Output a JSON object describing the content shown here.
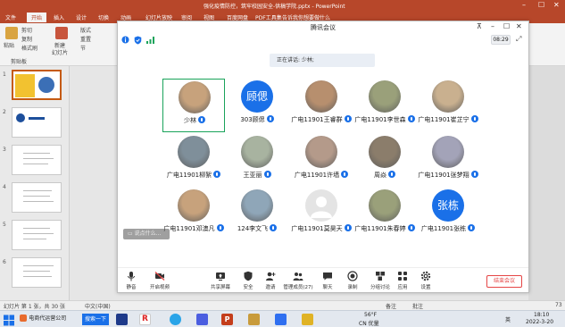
{
  "powerpoint": {
    "title": "强化疫情防控，筑牢校园安全-供稿学院.pptx  -  PowerPoint",
    "tabs": [
      "文件",
      "开始",
      "插入",
      "设计",
      "切换",
      "动画",
      "幻灯片放映",
      "审阅",
      "视图",
      "百度网盘",
      "PDF工具集"
    ],
    "active_tab": "开始",
    "search_placeholder": "告诉我你想要做什么",
    "ribbon": {
      "paste": "粘贴",
      "cut": "剪切",
      "copy": "复制",
      "format_painter": "格式刷",
      "clipboard_group": "剪贴板",
      "new_slide": "新建",
      "new_slide_2": "幻灯片",
      "layout": "版式",
      "reset": "重置",
      "section": "节"
    },
    "slide_numbers": [
      "1",
      "2",
      "3",
      "4",
      "5",
      "6"
    ],
    "status": {
      "slide_info": "幻灯片 第 1 张，共 30 张",
      "language": "中文(中国)",
      "notes": "备注",
      "comments": "批注",
      "zoom": "73"
    }
  },
  "meeting": {
    "title": "腾讯会议",
    "clock": "08:29",
    "speaking": "正在讲话: 少林;",
    "chat_placeholder": "说点什么...",
    "participants": [
      {
        "name": "少林",
        "avatar": "photo",
        "selected": true
      },
      {
        "name": "303顾偲",
        "avatar": "text",
        "avatar_text": "顾偲"
      },
      {
        "name": "广电11901王睿群",
        "avatar": "photo"
      },
      {
        "name": "广电11901李世森",
        "avatar": "photo"
      },
      {
        "name": "广电11901崔芷宁",
        "avatar": "photo"
      },
      {
        "name": "广电11901柳絮",
        "avatar": "photo"
      },
      {
        "name": "王亚丽",
        "avatar": "photo"
      },
      {
        "name": "广电11901许墙",
        "avatar": "photo"
      },
      {
        "name": "周焱",
        "avatar": "photo"
      },
      {
        "name": "广电11901张梦翔",
        "avatar": "photo"
      },
      {
        "name": "广电11901邓澳凡",
        "avatar": "photo"
      },
      {
        "name": "124李文飞",
        "avatar": "photo"
      },
      {
        "name": "广电11901莫昊天",
        "avatar": "default"
      },
      {
        "name": "广电11901朱春婷",
        "avatar": "photo"
      },
      {
        "name": "广电11901张栋",
        "avatar": "text",
        "avatar_text": "张栋"
      }
    ],
    "toolbar": {
      "mute": "静音",
      "video": "开启视频",
      "share": "共享屏幕",
      "security": "安全",
      "invite": "邀请",
      "members": "管理成员(27)",
      "chat": "聊天",
      "record": "录制",
      "breakout": "分组讨论",
      "apps": "应用",
      "settings": "设置",
      "end": "结束会议"
    },
    "accent_color": "#1a70e8",
    "end_color": "#e54545"
  },
  "taskbar": {
    "search_label": "搜索一下",
    "window_label": "电商代运营公司",
    "temperature": "56°F",
    "aqi": "CN 优量",
    "ime": "英",
    "time": "18:10",
    "date": "2022-3-20"
  }
}
